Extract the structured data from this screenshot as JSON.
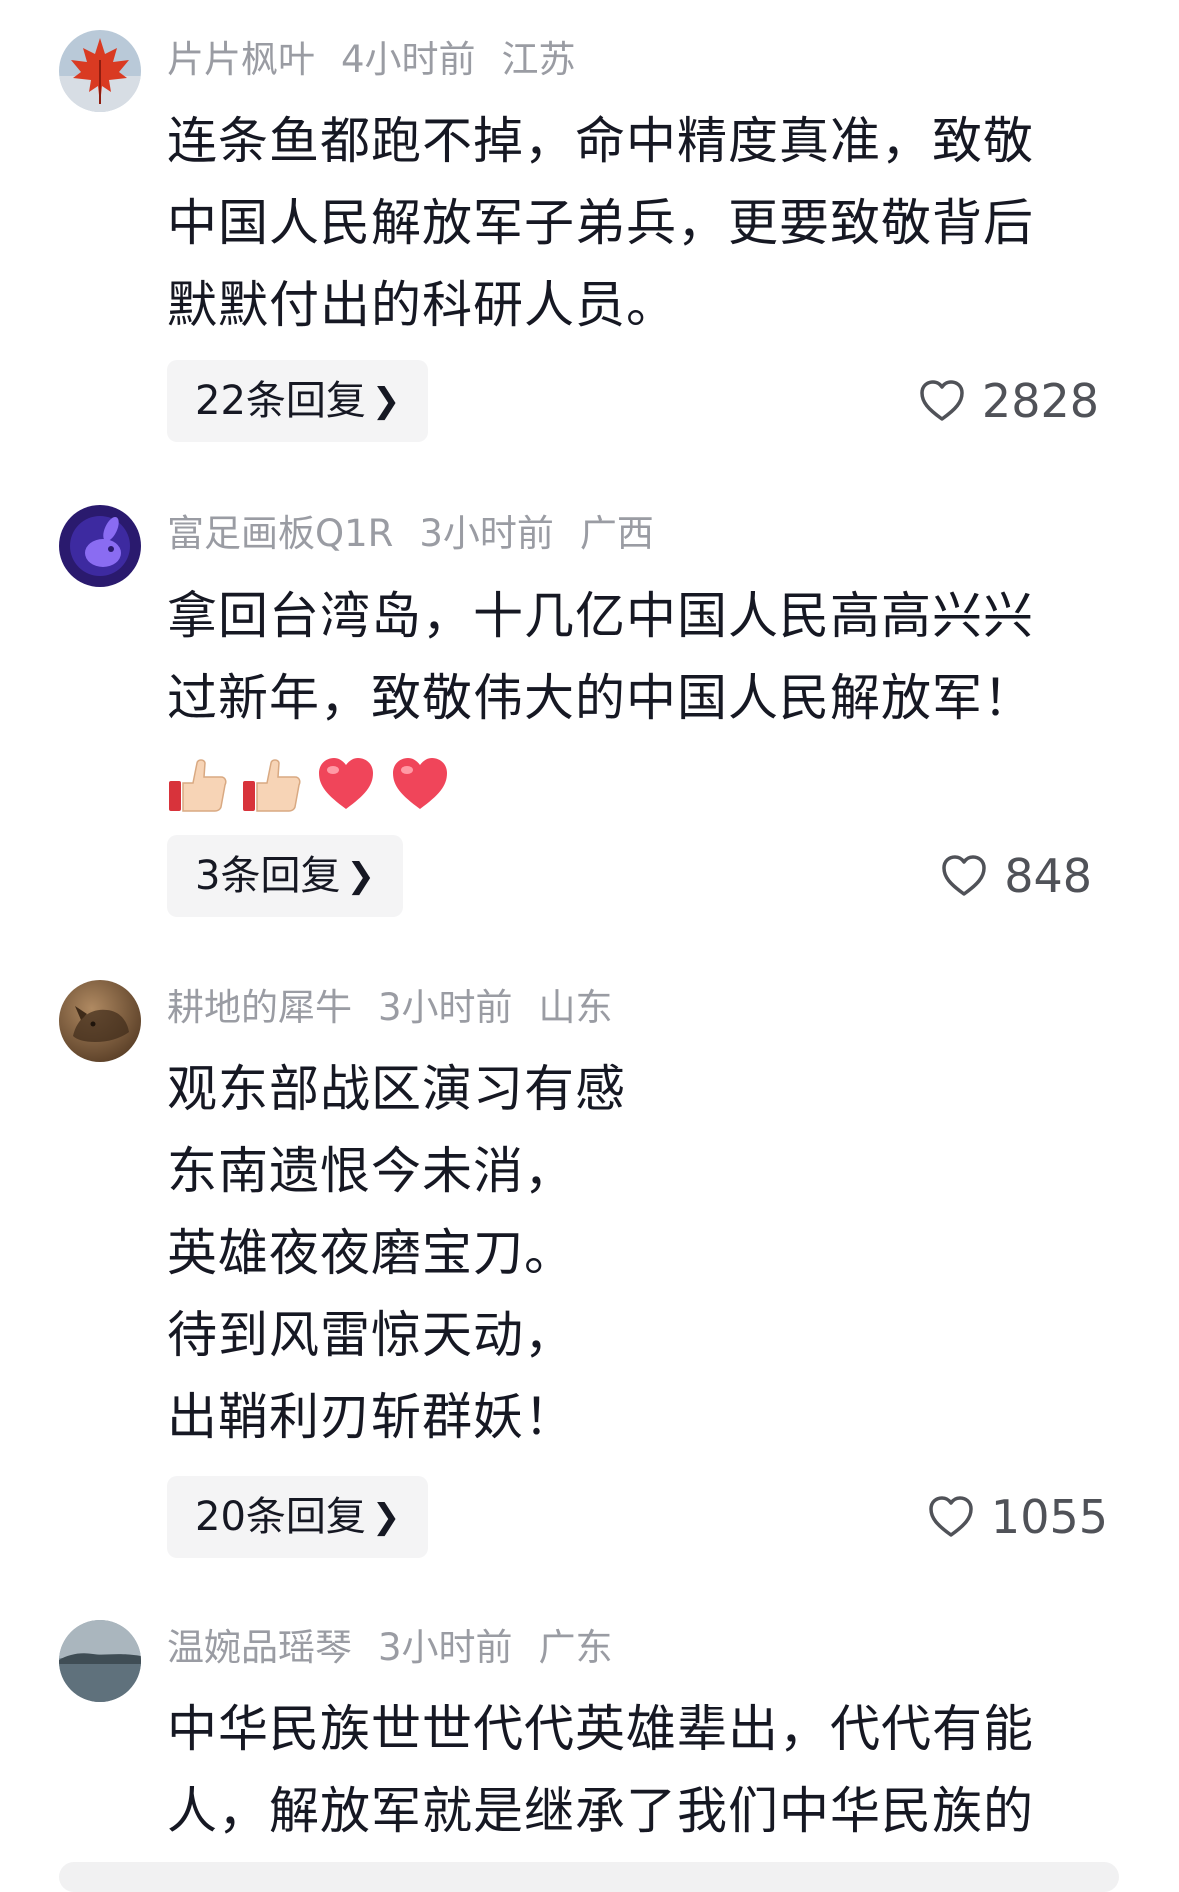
{
  "comments": [
    {
      "username": "片片枫叶",
      "time": "4小时前",
      "location": "江苏",
      "avatar": "red-maple-leaf-avatar",
      "lines": [
        "连条鱼都跑不掉，命中精度真准，致敬",
        "中国人民解放军子弟兵，更要致敬背后",
        "默默付出的科研人员。"
      ],
      "reply_label": "22条回复",
      "likes": "2828"
    },
    {
      "username": "富足画板Q1R",
      "time": "3小时前",
      "location": "广西",
      "avatar": "purple-rabbit-avatar",
      "lines": [
        "拿回台湾岛，十几亿中国人民高高兴兴",
        "过新年，致敬伟大的中国人民解放军！"
      ],
      "emojis": [
        "thumbs-up-emoji",
        "thumbs-up-emoji",
        "red-heart-emoji",
        "red-heart-emoji"
      ],
      "reply_label": "3条回复",
      "likes": "848"
    },
    {
      "username": "耕地的犀牛",
      "time": "3小时前",
      "location": "山东",
      "avatar": "bronze-rhino-avatar",
      "lines": [
        "观东部战区演习有感",
        "东南遗恨今未消，",
        "英雄夜夜磨宝刀。",
        "待到风雷惊天动，",
        "出鞘利刃斩群妖！"
      ],
      "reply_label": "20条回复",
      "likes": "1055"
    },
    {
      "username": "温婉品瑶琴",
      "time": "3小时前",
      "location": "广东",
      "avatar": "lake-landscape-avatar",
      "lines": [
        "中华民族世世代代英雄辈出，代代有能",
        "人，解放军就是继承了我们中华民族的"
      ]
    }
  ],
  "icons": {
    "reply_chevron": "chevron-right-icon",
    "like": "heart-outline-icon"
  },
  "colors": {
    "text": "#161823",
    "meta": "#9a9ca3",
    "reply_bg": "#f4f4f5",
    "like_text": "#505258"
  }
}
